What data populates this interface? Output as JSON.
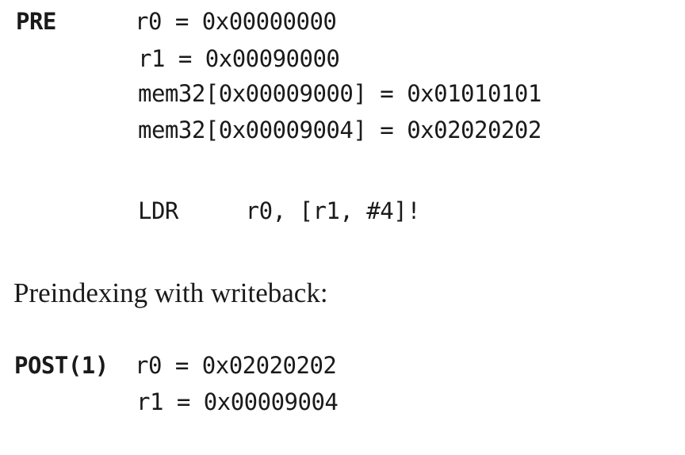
{
  "pre": {
    "label": "PRE",
    "lines": [
      "r0 = 0x00000000",
      "r1 = 0x00090000",
      "mem32[0x00009000] = 0x01010101",
      "mem32[0x00009004] = 0x02020202"
    ]
  },
  "instruction": "LDR     r0, [r1, #4]!",
  "caption": "Preindexing with writeback:",
  "post": {
    "label": "POST(1)",
    "lines": [
      "r0 = 0x02020202",
      "r1 = 0x00009004"
    ]
  }
}
